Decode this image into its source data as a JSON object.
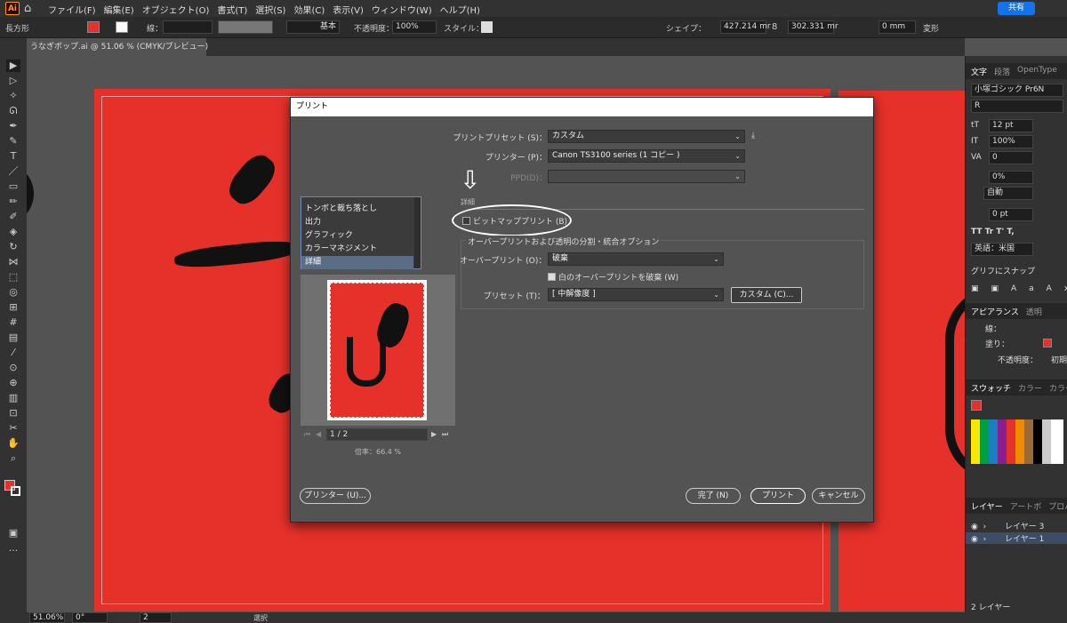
{
  "menubar": {
    "app_badge": "Ai",
    "items": [
      "ファイル(F)",
      "編集(E)",
      "オブジェクト(O)",
      "書式(T)",
      "選択(S)",
      "効果(C)",
      "表示(V)",
      "ウィンドウ(W)",
      "ヘルプ(H)"
    ],
    "share_label": "共有"
  },
  "control": {
    "tool_name": "長方形",
    "stroke_label": "線：",
    "stroke_style": "基本",
    "opacity_label": "不透明度：",
    "opacity_value": "100%",
    "style_label": "スタイル：",
    "shape_label": "シェイプ：",
    "width_value": "427.214 mr",
    "height_value": "302.331 mr",
    "corner_value": "0 mm",
    "transform_label": "変形"
  },
  "tab": {
    "doc_title": "うなぎボップ.ai @ 51.06 % (CMYK/プレビュー)"
  },
  "right_panel": {
    "tabs": [
      "文字",
      "段落",
      "OpenType"
    ],
    "font_name": "小塚ゴシック Pr6N",
    "font_style": "R",
    "size": "12 pt",
    "scale": "100%",
    "tracking": "0",
    "kerning": "0%",
    "auto": "自動",
    "baseline": "0 pt",
    "language": "英語：米国",
    "snap_label": "グリフにスナップ",
    "appearance_tabs": [
      "アピアランス",
      "透明"
    ],
    "stroke_row": "線：",
    "fill_row": "塗り：",
    "opacity_row": "不透明度：",
    "opacity_default": "初期",
    "swatch_tabs": [
      "スウォッチ",
      "カラー",
      "カラーガイド"
    ],
    "layer_tabs": [
      "レイヤー",
      "アートボ",
      "プロパティ"
    ],
    "layers": [
      "レイヤー 3",
      "レイヤー 1"
    ],
    "layer_count": "2 レイヤー",
    "colors": {
      "accent": "#e5312a",
      "selection": "#5a6d84"
    }
  },
  "status": {
    "zoom": "51.06%",
    "rotation": "0°",
    "artboard": "2",
    "tool": "選択"
  },
  "dialog": {
    "title": "プリント",
    "preset_label": "プリントプリセット (S)：",
    "preset_value": "カスタム",
    "printer_label": "プリンター (P)：",
    "printer_value": "Canon TS3100 series (1 コピー )",
    "ppd_label": "PPD(D)：",
    "section_title": "詳細",
    "bitmap_label": "ビットマッププリント (B)",
    "overprint_group": "オーバープリントおよび透明の分割・統合オプション",
    "overprint_label": "オーバープリント (O)：",
    "overprint_value": "破棄",
    "white_overprint_label": "白のオーバープリントを破棄 (W)",
    "preset2_label": "プリセット (T)：",
    "preset2_value": "[ 中解像度 ]",
    "custom_button": "カスタム (C)...",
    "categories": [
      "トンボと裁ち落とし",
      "出力",
      "グラフィック",
      "カラーマネジメント",
      "詳細"
    ],
    "page_indicator": "1 / 2",
    "scale_label": "倍率：66.4 %",
    "printer_button": "プリンター (U)...",
    "done_button": "完了 (N)",
    "print_button": "プリント",
    "cancel_button": "キャンセル"
  }
}
